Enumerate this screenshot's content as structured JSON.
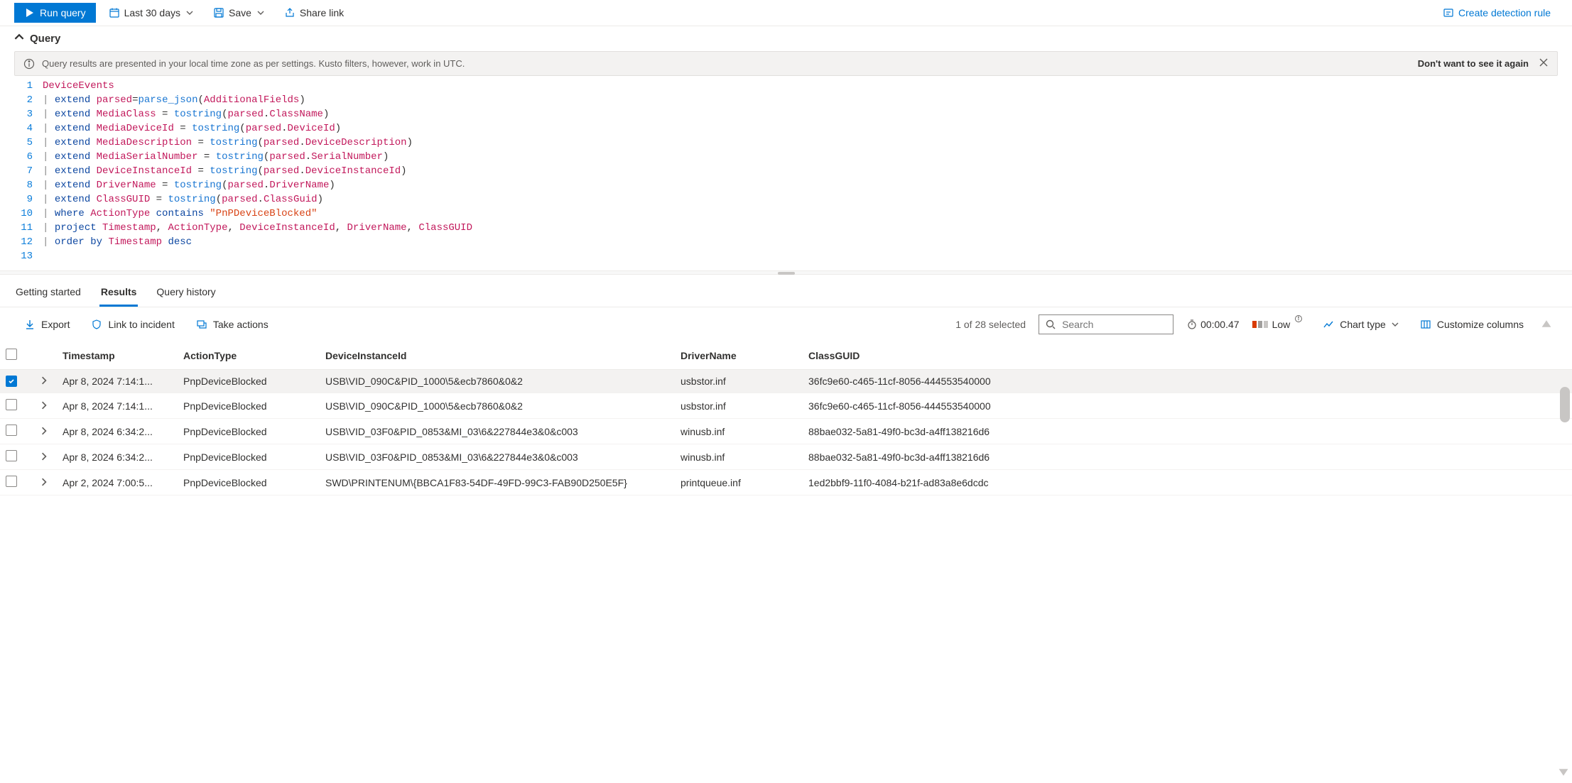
{
  "toolbar": {
    "run_query": "Run query",
    "time_range": "Last 30 days",
    "save": "Save",
    "share_link": "Share link",
    "create_detection": "Create detection rule"
  },
  "section": {
    "title": "Query"
  },
  "banner": {
    "text": "Query results are presented in your local time zone as per settings. Kusto filters, however, work in UTC.",
    "dont_show": "Don't want to see it again"
  },
  "editor": {
    "lines": [
      {
        "n": 1,
        "tokens": [
          {
            "c": "tok-table",
            "t": "DeviceEvents"
          }
        ]
      },
      {
        "n": 2,
        "tokens": [
          {
            "c": "tok-pipe",
            "t": "| "
          },
          {
            "c": "tok-kw",
            "t": "extend"
          },
          {
            "c": "tok-plain",
            "t": " "
          },
          {
            "c": "tok-id",
            "t": "parsed"
          },
          {
            "c": "tok-plain",
            "t": "="
          },
          {
            "c": "tok-fn",
            "t": "parse_json"
          },
          {
            "c": "tok-plain",
            "t": "("
          },
          {
            "c": "tok-id",
            "t": "AdditionalFields"
          },
          {
            "c": "tok-plain",
            "t": ")"
          }
        ]
      },
      {
        "n": 3,
        "tokens": [
          {
            "c": "tok-pipe",
            "t": "| "
          },
          {
            "c": "tok-kw",
            "t": "extend"
          },
          {
            "c": "tok-plain",
            "t": " "
          },
          {
            "c": "tok-id",
            "t": "MediaClass"
          },
          {
            "c": "tok-plain",
            "t": " = "
          },
          {
            "c": "tok-fn",
            "t": "tostring"
          },
          {
            "c": "tok-plain",
            "t": "("
          },
          {
            "c": "tok-id",
            "t": "parsed"
          },
          {
            "c": "tok-plain",
            "t": "."
          },
          {
            "c": "tok-id",
            "t": "ClassName"
          },
          {
            "c": "tok-plain",
            "t": ")"
          }
        ]
      },
      {
        "n": 4,
        "tokens": [
          {
            "c": "tok-pipe",
            "t": "| "
          },
          {
            "c": "tok-kw",
            "t": "extend"
          },
          {
            "c": "tok-plain",
            "t": " "
          },
          {
            "c": "tok-id",
            "t": "MediaDeviceId"
          },
          {
            "c": "tok-plain",
            "t": " = "
          },
          {
            "c": "tok-fn",
            "t": "tostring"
          },
          {
            "c": "tok-plain",
            "t": "("
          },
          {
            "c": "tok-id",
            "t": "parsed"
          },
          {
            "c": "tok-plain",
            "t": "."
          },
          {
            "c": "tok-id",
            "t": "DeviceId"
          },
          {
            "c": "tok-plain",
            "t": ")"
          }
        ]
      },
      {
        "n": 5,
        "tokens": [
          {
            "c": "tok-pipe",
            "t": "| "
          },
          {
            "c": "tok-kw",
            "t": "extend"
          },
          {
            "c": "tok-plain",
            "t": " "
          },
          {
            "c": "tok-id",
            "t": "MediaDescription"
          },
          {
            "c": "tok-plain",
            "t": " = "
          },
          {
            "c": "tok-fn",
            "t": "tostring"
          },
          {
            "c": "tok-plain",
            "t": "("
          },
          {
            "c": "tok-id",
            "t": "parsed"
          },
          {
            "c": "tok-plain",
            "t": "."
          },
          {
            "c": "tok-id",
            "t": "DeviceDescription"
          },
          {
            "c": "tok-plain",
            "t": ")"
          }
        ]
      },
      {
        "n": 6,
        "tokens": [
          {
            "c": "tok-pipe",
            "t": "| "
          },
          {
            "c": "tok-kw",
            "t": "extend"
          },
          {
            "c": "tok-plain",
            "t": " "
          },
          {
            "c": "tok-id",
            "t": "MediaSerialNumber"
          },
          {
            "c": "tok-plain",
            "t": " = "
          },
          {
            "c": "tok-fn",
            "t": "tostring"
          },
          {
            "c": "tok-plain",
            "t": "("
          },
          {
            "c": "tok-id",
            "t": "parsed"
          },
          {
            "c": "tok-plain",
            "t": "."
          },
          {
            "c": "tok-id",
            "t": "SerialNumber"
          },
          {
            "c": "tok-plain",
            "t": ")"
          }
        ]
      },
      {
        "n": 7,
        "tokens": [
          {
            "c": "tok-pipe",
            "t": "| "
          },
          {
            "c": "tok-kw",
            "t": "extend"
          },
          {
            "c": "tok-plain",
            "t": " "
          },
          {
            "c": "tok-id",
            "t": "DeviceInstanceId"
          },
          {
            "c": "tok-plain",
            "t": " = "
          },
          {
            "c": "tok-fn",
            "t": "tostring"
          },
          {
            "c": "tok-plain",
            "t": "("
          },
          {
            "c": "tok-id",
            "t": "parsed"
          },
          {
            "c": "tok-plain",
            "t": "."
          },
          {
            "c": "tok-id",
            "t": "DeviceInstanceId"
          },
          {
            "c": "tok-plain",
            "t": ")"
          }
        ]
      },
      {
        "n": 8,
        "tokens": [
          {
            "c": "tok-pipe",
            "t": "| "
          },
          {
            "c": "tok-kw",
            "t": "extend"
          },
          {
            "c": "tok-plain",
            "t": " "
          },
          {
            "c": "tok-id",
            "t": "DriverName"
          },
          {
            "c": "tok-plain",
            "t": " = "
          },
          {
            "c": "tok-fn",
            "t": "tostring"
          },
          {
            "c": "tok-plain",
            "t": "("
          },
          {
            "c": "tok-id",
            "t": "parsed"
          },
          {
            "c": "tok-plain",
            "t": "."
          },
          {
            "c": "tok-id",
            "t": "DriverName"
          },
          {
            "c": "tok-plain",
            "t": ")"
          }
        ]
      },
      {
        "n": 9,
        "tokens": [
          {
            "c": "tok-pipe",
            "t": "| "
          },
          {
            "c": "tok-kw",
            "t": "extend"
          },
          {
            "c": "tok-plain",
            "t": " "
          },
          {
            "c": "tok-id",
            "t": "ClassGUID"
          },
          {
            "c": "tok-plain",
            "t": " = "
          },
          {
            "c": "tok-fn",
            "t": "tostring"
          },
          {
            "c": "tok-plain",
            "t": "("
          },
          {
            "c": "tok-id",
            "t": "parsed"
          },
          {
            "c": "tok-plain",
            "t": "."
          },
          {
            "c": "tok-id",
            "t": "ClassGuid"
          },
          {
            "c": "tok-plain",
            "t": ")"
          }
        ]
      },
      {
        "n": 10,
        "tokens": [
          {
            "c": "tok-pipe",
            "t": "| "
          },
          {
            "c": "tok-kw",
            "t": "where"
          },
          {
            "c": "tok-plain",
            "t": " "
          },
          {
            "c": "tok-id",
            "t": "ActionType"
          },
          {
            "c": "tok-plain",
            "t": " "
          },
          {
            "c": "tok-kw",
            "t": "contains"
          },
          {
            "c": "tok-plain",
            "t": " "
          },
          {
            "c": "tok-str",
            "t": "\"PnPDeviceBlocked\""
          }
        ]
      },
      {
        "n": 11,
        "tokens": [
          {
            "c": "tok-pipe",
            "t": "| "
          },
          {
            "c": "tok-kw",
            "t": "project"
          },
          {
            "c": "tok-plain",
            "t": " "
          },
          {
            "c": "tok-id",
            "t": "Timestamp"
          },
          {
            "c": "tok-plain",
            "t": ", "
          },
          {
            "c": "tok-id",
            "t": "ActionType"
          },
          {
            "c": "tok-plain",
            "t": ", "
          },
          {
            "c": "tok-id",
            "t": "DeviceInstanceId"
          },
          {
            "c": "tok-plain",
            "t": ", "
          },
          {
            "c": "tok-id",
            "t": "DriverName"
          },
          {
            "c": "tok-plain",
            "t": ", "
          },
          {
            "c": "tok-id",
            "t": "ClassGUID"
          }
        ]
      },
      {
        "n": 12,
        "tokens": [
          {
            "c": "tok-pipe",
            "t": "| "
          },
          {
            "c": "tok-kw",
            "t": "order by"
          },
          {
            "c": "tok-plain",
            "t": " "
          },
          {
            "c": "tok-id",
            "t": "Timestamp"
          },
          {
            "c": "tok-plain",
            "t": " "
          },
          {
            "c": "tok-kw",
            "t": "desc"
          }
        ]
      },
      {
        "n": 13,
        "tokens": []
      }
    ]
  },
  "tabs": {
    "items": [
      "Getting started",
      "Results",
      "Query history"
    ],
    "active": 1
  },
  "results_bar": {
    "export": "Export",
    "link_incident": "Link to incident",
    "take_actions": "Take actions",
    "selection": "1 of 28 selected",
    "search_placeholder": "Search",
    "timer": "00:00.47",
    "severity": "Low",
    "chart_type": "Chart type",
    "customize": "Customize columns"
  },
  "table": {
    "headers": [
      "Timestamp",
      "ActionType",
      "DeviceInstanceId",
      "DriverName",
      "ClassGUID"
    ],
    "rows": [
      {
        "selected": true,
        "ts": "Apr 8, 2024 7:14:1...",
        "action": "PnpDeviceBlocked",
        "inst": "USB\\VID_090C&PID_1000\\5&ecb7860&0&2",
        "driver": "usbstor.inf",
        "guid": "36fc9e60-c465-11cf-8056-444553540000"
      },
      {
        "selected": false,
        "ts": "Apr 8, 2024 7:14:1...",
        "action": "PnpDeviceBlocked",
        "inst": "USB\\VID_090C&PID_1000\\5&ecb7860&0&2",
        "driver": "usbstor.inf",
        "guid": "36fc9e60-c465-11cf-8056-444553540000"
      },
      {
        "selected": false,
        "ts": "Apr 8, 2024 6:34:2...",
        "action": "PnpDeviceBlocked",
        "inst": "USB\\VID_03F0&PID_0853&MI_03\\6&227844e3&0&c003",
        "driver": "winusb.inf",
        "guid": "88bae032-5a81-49f0-bc3d-a4ff138216d6"
      },
      {
        "selected": false,
        "ts": "Apr 8, 2024 6:34:2...",
        "action": "PnpDeviceBlocked",
        "inst": "USB\\VID_03F0&PID_0853&MI_03\\6&227844e3&0&c003",
        "driver": "winusb.inf",
        "guid": "88bae032-5a81-49f0-bc3d-a4ff138216d6"
      },
      {
        "selected": false,
        "ts": "Apr 2, 2024 7:00:5...",
        "action": "PnpDeviceBlocked",
        "inst": "SWD\\PRINTENUM\\{BBCA1F83-54DF-49FD-99C3-FAB90D250E5F}",
        "driver": "printqueue.inf",
        "guid": "1ed2bbf9-11f0-4084-b21f-ad83a8e6dcdc"
      }
    ]
  }
}
